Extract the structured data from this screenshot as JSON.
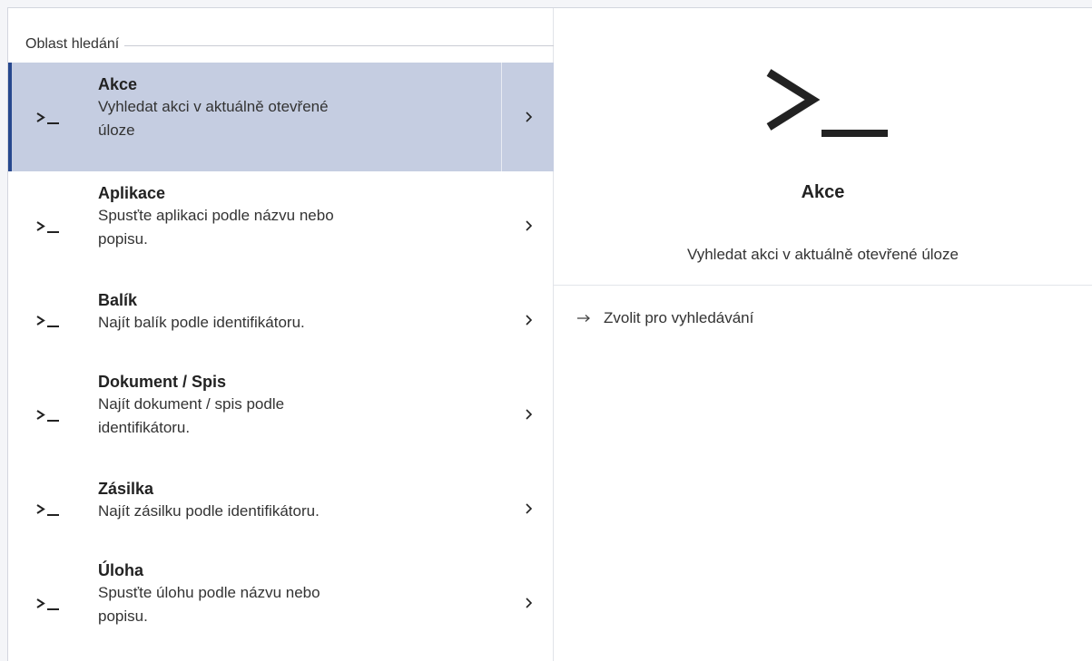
{
  "search_area": {
    "label": "Oblast hledání"
  },
  "items": [
    {
      "title": "Akce",
      "description_lines": [
        "Vyhledat akci v aktuálně otevřené",
        "úloze"
      ],
      "icon": "terminal-prompt-icon",
      "selected": true
    },
    {
      "title": "Aplikace",
      "description_lines": [
        "Spusťte aplikaci podle názvu nebo",
        "popisu."
      ],
      "icon": "terminal-prompt-icon",
      "selected": false
    },
    {
      "title": "Balík",
      "description_lines": [
        "Najít balík podle identifikátoru."
      ],
      "icon": "terminal-prompt-icon",
      "selected": false
    },
    {
      "title": "Dokument / Spis",
      "description_lines": [
        "Najít dokument / spis podle",
        "identifikátoru."
      ],
      "icon": "terminal-prompt-icon",
      "selected": false
    },
    {
      "title": "Zásilka",
      "description_lines": [
        "Najít zásilku podle identifikátoru."
      ],
      "icon": "terminal-prompt-icon",
      "selected": false
    },
    {
      "title": "Úloha",
      "description_lines": [
        "Spusťte úlohu podle názvu nebo",
        "popisu."
      ],
      "icon": "terminal-prompt-icon",
      "selected": false
    }
  ],
  "detail": {
    "icon": "terminal-prompt-icon",
    "title": "Akce",
    "description": "Vyhledat akci v aktuálně otevřené úloze",
    "action_label": "Zvolit pro vyhledávání",
    "action_icon": "arrow-right-icon"
  },
  "colors": {
    "selected_background": "#c5cde1",
    "selected_accent": "#27488e",
    "background": "#ffffff",
    "icon_color": "#222222"
  }
}
